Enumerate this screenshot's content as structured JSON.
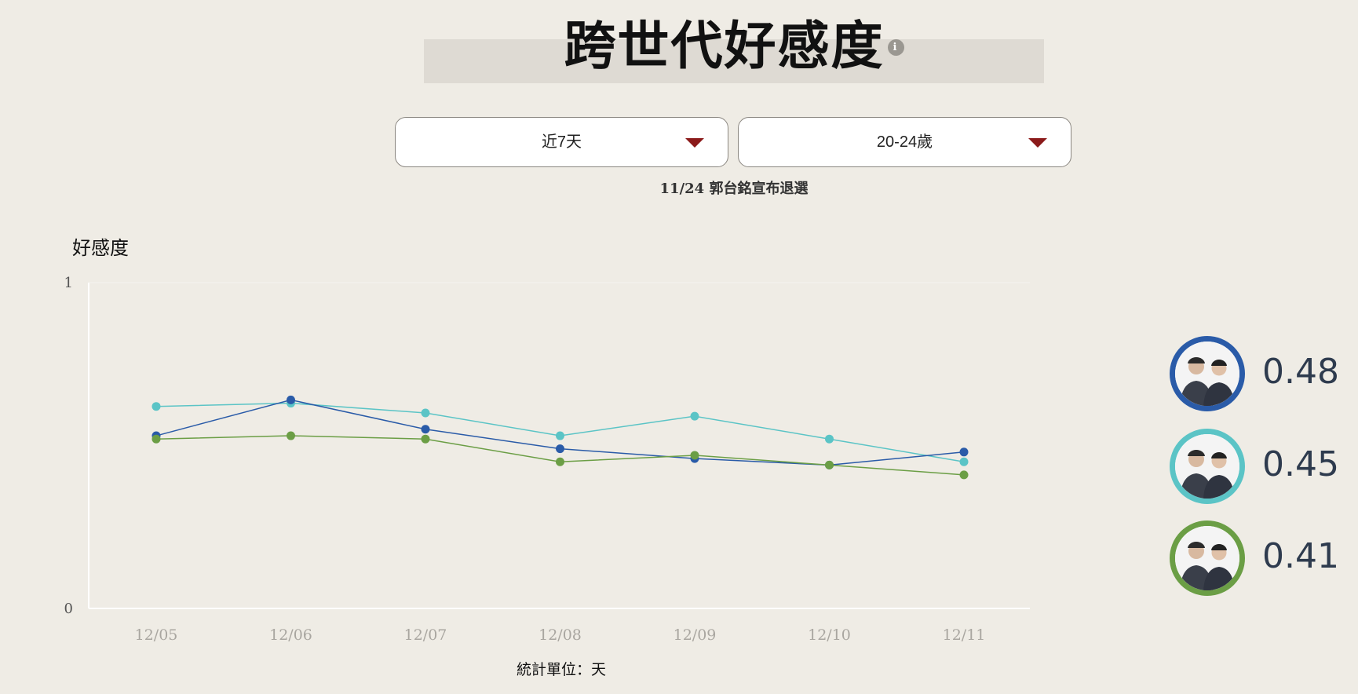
{
  "header": {
    "title": "跨世代好感度",
    "info_icon": "i"
  },
  "filters": {
    "period": {
      "selected": "近7天"
    },
    "age": {
      "selected": "20-24歲"
    }
  },
  "note": "11/24 郭台銘宣布退選",
  "footer": {
    "unit": "統計單位：天"
  },
  "colors": {
    "blue": "#2a5ba8",
    "teal": "#5bc4c6",
    "green": "#6b9e45",
    "caret": "#8b1a1a"
  },
  "legend": [
    {
      "name": "blue",
      "value": "0.48",
      "color": "#2a5ba8"
    },
    {
      "name": "teal",
      "value": "0.45",
      "color": "#5bc4c6"
    },
    {
      "name": "green",
      "value": "0.41",
      "color": "#6b9e45"
    }
  ],
  "chart_data": {
    "type": "line",
    "title": "",
    "xlabel": "",
    "ylabel": "好感度",
    "ylim": [
      0,
      1
    ],
    "yticks": [
      "0",
      "1"
    ],
    "grid": false,
    "categories": [
      "12/05",
      "12/06",
      "12/07",
      "12/08",
      "12/09",
      "12/10",
      "12/11"
    ],
    "series": [
      {
        "color": "#5bc4c6",
        "values": [
          0.62,
          0.63,
          0.6,
          0.53,
          0.59,
          0.52,
          0.45
        ]
      },
      {
        "color": "#2a5ba8",
        "values": [
          0.53,
          0.64,
          0.55,
          0.49,
          0.46,
          0.44,
          0.48
        ]
      },
      {
        "color": "#6b9e45",
        "values": [
          0.52,
          0.53,
          0.52,
          0.45,
          0.47,
          0.44,
          0.41
        ]
      }
    ]
  }
}
